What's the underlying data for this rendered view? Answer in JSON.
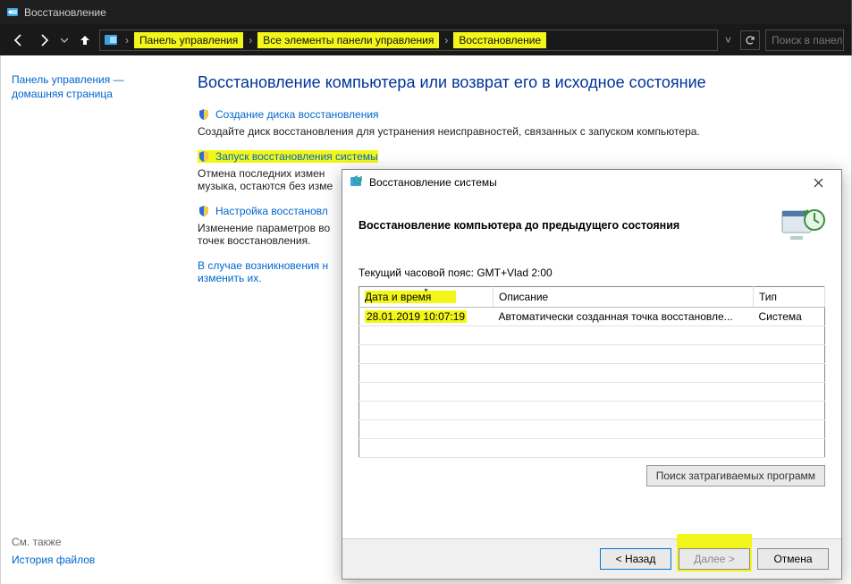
{
  "titlebar": {
    "title": "Восстановление"
  },
  "nav": {
    "breadcrumb": [
      "Панель управления",
      "Все элементы панели управления",
      "Восстановление"
    ],
    "search_placeholder": "Поиск в панели"
  },
  "sidebar": {
    "home_label": "Панель управления — домашняя страница",
    "see_also_label": "См. также",
    "history_label": "История файлов"
  },
  "main": {
    "heading": "Восстановление компьютера или возврат его в исходное состояние",
    "items": [
      {
        "link": "Создание диска восстановления",
        "desc": "Создайте диск восстановления для устранения неисправностей, связанных с запуском компьютера.",
        "highlight": false
      },
      {
        "link": "Запуск восстановления системы",
        "desc": "Отменa последних измен­музыка, остаются без изме",
        "highlight": true
      },
      {
        "link": "Настройка восстановл",
        "desc": "Изменение параметров во­точек восстановления.",
        "highlight": false
      }
    ],
    "note_link": "В случае возникновения н",
    "note_link2": "изменить их"
  },
  "dialog": {
    "title": "Восстановление системы",
    "heading": "Восстановление компьютера до предыдущего состояния",
    "tz_label": "Текущий часовой пояс: GMT+Vlad 2:00",
    "columns": {
      "datetime": "Дата и время",
      "desc": "Описание",
      "type": "Тип"
    },
    "rows": [
      {
        "datetime": "28.01.2019 10:07:19",
        "desc": "Автоматически созданная точка восстановле...",
        "type": "Система"
      }
    ],
    "search_programs_btn": "Поиск затрагиваемых программ",
    "back_btn": "< Назад",
    "next_btn": "Далее >",
    "cancel_btn": "Отмена"
  }
}
